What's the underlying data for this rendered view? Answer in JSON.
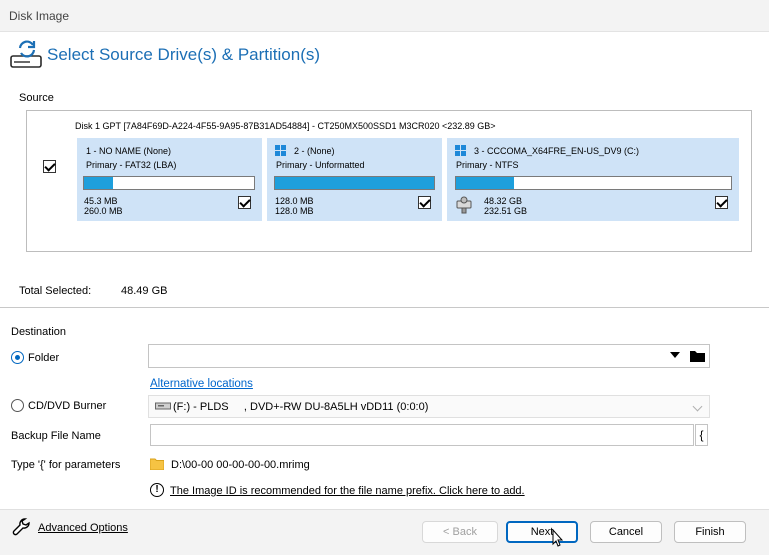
{
  "window": {
    "title": "Disk Image"
  },
  "header": {
    "title": "Select Source Drive(s) & Partition(s)",
    "icon": "disk-image-icon"
  },
  "source": {
    "label": "Source",
    "disk_info": "Disk 1 GPT [7A84F69D-A224-4F55-9A95-87B31AD54884] - CT250MX500SSD1 M3CR020  <232.89 GB>",
    "disk_checked": true,
    "partitions": [
      {
        "title": "1 - NO NAME (None)",
        "type": "Primary - FAT32 (LBA)",
        "used": "45.3 MB",
        "total": "260.0 MB",
        "used_fraction": 0.17,
        "checked": true,
        "icon": "none"
      },
      {
        "title": "2 -  (None)",
        "type": "Primary - Unformatted",
        "used": "128.0 MB",
        "total": "128.0 MB",
        "used_fraction": 1.0,
        "checked": true,
        "icon": "windows-icon"
      },
      {
        "title": "3 - CCCOMA_X64FRE_EN-US_DV9 (C:)",
        "type": "Primary - NTFS",
        "used": "48.32 GB",
        "total": "232.51 GB",
        "used_fraction": 0.21,
        "checked": true,
        "icon": "windows-icon"
      }
    ]
  },
  "total": {
    "label": "Total Selected:",
    "value": "48.49 GB"
  },
  "destination": {
    "label": "Destination",
    "folder_label": "Folder",
    "folder_selected": true,
    "folder_value": "",
    "alt_locations": "Alternative locations",
    "cd_label": "CD/DVD Burner",
    "cd_value": "(F:) - PLDS     , DVD+-RW DU-8A5LH vDD11 (0:0:0)",
    "backup_label": "Backup File Name",
    "backup_value": "",
    "param_button": "{",
    "type_hint": "Type '{' for parameters",
    "path": "D:\\00-00 00-00-00-00.mrimg",
    "notice": "The Image ID is recommended for the file name prefix. Click here to add."
  },
  "footer": {
    "advanced": "Advanced Options",
    "back": "< Back",
    "next": "Next",
    "cancel": "Cancel",
    "finish": "Finish"
  },
  "colors": {
    "accent": "#1c6fb5",
    "partition_bg": "#cfe3f7",
    "bar_fill": "#1e9fdc"
  }
}
